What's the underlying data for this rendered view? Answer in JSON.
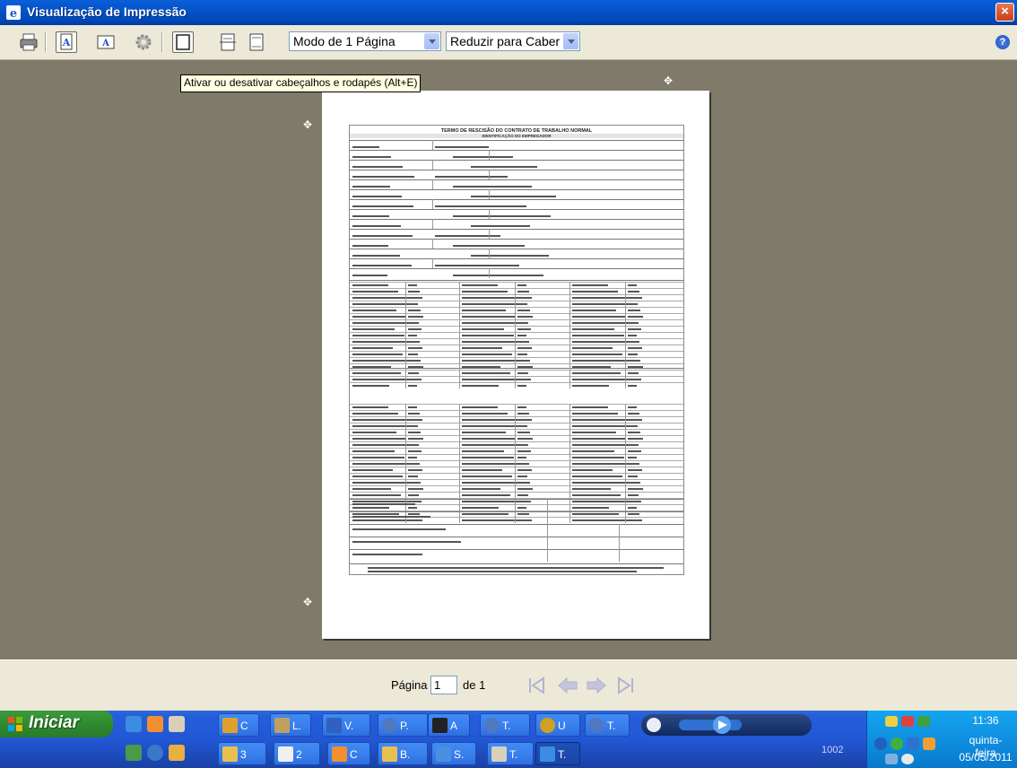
{
  "window": {
    "title": "Visualização de Impressão",
    "close_label": "×"
  },
  "toolbar": {
    "page_mode": "Modo de 1 Página",
    "fit_mode": "Reduzir para Caber",
    "help_label": "?"
  },
  "tooltip": "Ativar ou desativar cabeçalhos e rodapés (Alt+E)",
  "document": {
    "title": "TERMO DE RESCISÃO DO CONTRATO DE TRABALHO NORMAL",
    "sections": [
      "IDENTIFICAÇÃO DO EMPREGADOR",
      "IDENTIFICAÇÃO DO TRABALHADOR",
      "DADOS DO CONTRATO",
      "DISCRIMINAÇÃO DAS VERBAS RESCISÓRIAS",
      "FORMALIZAÇÃO DA RESCISÃO"
    ]
  },
  "navigation": {
    "page_label": "Página",
    "current_page": "1",
    "of_label": "de 1"
  },
  "taskbar": {
    "start_label": "Iniciar",
    "tasks_row1": [
      "C",
      "L.",
      "V.",
      "P.",
      "A",
      "T.",
      "U",
      "T."
    ],
    "tasks_row2": [
      "3",
      "2",
      "C",
      "B.",
      "S.",
      "T.",
      "T."
    ],
    "tray_number": "1002",
    "time": "11:36",
    "day": "quinta-feira",
    "date": "05/05/2011"
  }
}
